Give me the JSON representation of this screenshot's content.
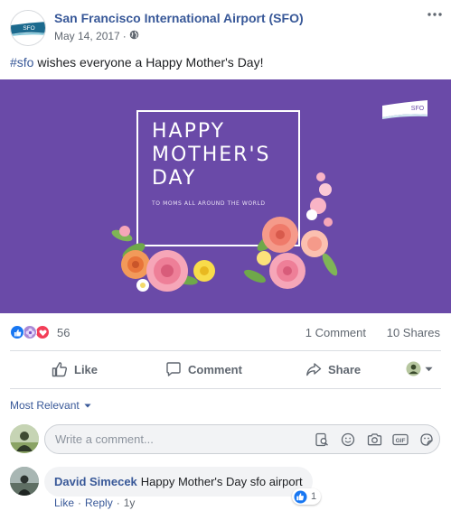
{
  "post": {
    "page_name": "San Francisco International Airport (SFO)",
    "date": "May 14, 2017",
    "meta_separator": "·",
    "audience_icon": "globe-icon",
    "more_icon": "more-dots-icon",
    "avatar_logo_text": "SFO",
    "hashtag": "#sfo",
    "text_rest": " wishes everyone a Happy Mother's Day!"
  },
  "image": {
    "title_line1": "HAPPY",
    "title_line2": "MOTHER'S",
    "title_line3": "DAY",
    "subtitle": "TO MOMS ALL AROUND THE WORLD",
    "logo_text": "SFO",
    "background_color": "#6a4aa8"
  },
  "stats": {
    "reaction_icons": [
      "like-icon",
      "wow-flower-icon",
      "love-icon"
    ],
    "reaction_count": "56",
    "comments": "1 Comment",
    "shares": "10 Shares"
  },
  "actions": {
    "like": "Like",
    "comment": "Comment",
    "share": "Share"
  },
  "comments_section": {
    "sort_label": "Most Relevant",
    "composer_placeholder": "Write a comment...",
    "composer_tools": [
      "sticker-search-icon",
      "emoji-icon",
      "camera-icon",
      "gif-icon",
      "sticker-icon"
    ]
  },
  "comment": {
    "author": "David Simecek",
    "text": "Happy Mother's Day sfo airport",
    "like_count": "1",
    "like_action": "Like",
    "reply_action": "Reply",
    "separator": "·",
    "age": "1y"
  },
  "colors": {
    "link_blue": "#385898",
    "like_blue": "#1877f2",
    "love_red": "#f33e58",
    "muted_text": "#606770"
  }
}
